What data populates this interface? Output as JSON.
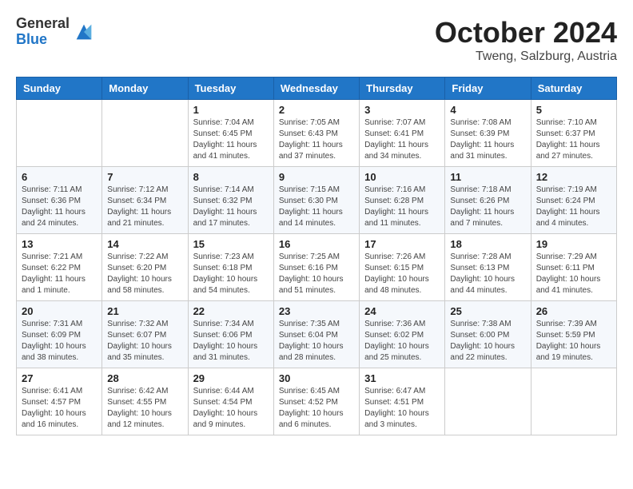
{
  "logo": {
    "general": "General",
    "blue": "Blue"
  },
  "header": {
    "month": "October 2024",
    "location": "Tweng, Salzburg, Austria"
  },
  "weekdays": [
    "Sunday",
    "Monday",
    "Tuesday",
    "Wednesday",
    "Thursday",
    "Friday",
    "Saturday"
  ],
  "weeks": [
    [
      {
        "day": "",
        "info": ""
      },
      {
        "day": "",
        "info": ""
      },
      {
        "day": "1",
        "info": "Sunrise: 7:04 AM\nSunset: 6:45 PM\nDaylight: 11 hours and 41 minutes."
      },
      {
        "day": "2",
        "info": "Sunrise: 7:05 AM\nSunset: 6:43 PM\nDaylight: 11 hours and 37 minutes."
      },
      {
        "day": "3",
        "info": "Sunrise: 7:07 AM\nSunset: 6:41 PM\nDaylight: 11 hours and 34 minutes."
      },
      {
        "day": "4",
        "info": "Sunrise: 7:08 AM\nSunset: 6:39 PM\nDaylight: 11 hours and 31 minutes."
      },
      {
        "day": "5",
        "info": "Sunrise: 7:10 AM\nSunset: 6:37 PM\nDaylight: 11 hours and 27 minutes."
      }
    ],
    [
      {
        "day": "6",
        "info": "Sunrise: 7:11 AM\nSunset: 6:36 PM\nDaylight: 11 hours and 24 minutes."
      },
      {
        "day": "7",
        "info": "Sunrise: 7:12 AM\nSunset: 6:34 PM\nDaylight: 11 hours and 21 minutes."
      },
      {
        "day": "8",
        "info": "Sunrise: 7:14 AM\nSunset: 6:32 PM\nDaylight: 11 hours and 17 minutes."
      },
      {
        "day": "9",
        "info": "Sunrise: 7:15 AM\nSunset: 6:30 PM\nDaylight: 11 hours and 14 minutes."
      },
      {
        "day": "10",
        "info": "Sunrise: 7:16 AM\nSunset: 6:28 PM\nDaylight: 11 hours and 11 minutes."
      },
      {
        "day": "11",
        "info": "Sunrise: 7:18 AM\nSunset: 6:26 PM\nDaylight: 11 hours and 7 minutes."
      },
      {
        "day": "12",
        "info": "Sunrise: 7:19 AM\nSunset: 6:24 PM\nDaylight: 11 hours and 4 minutes."
      }
    ],
    [
      {
        "day": "13",
        "info": "Sunrise: 7:21 AM\nSunset: 6:22 PM\nDaylight: 11 hours and 1 minute."
      },
      {
        "day": "14",
        "info": "Sunrise: 7:22 AM\nSunset: 6:20 PM\nDaylight: 10 hours and 58 minutes."
      },
      {
        "day": "15",
        "info": "Sunrise: 7:23 AM\nSunset: 6:18 PM\nDaylight: 10 hours and 54 minutes."
      },
      {
        "day": "16",
        "info": "Sunrise: 7:25 AM\nSunset: 6:16 PM\nDaylight: 10 hours and 51 minutes."
      },
      {
        "day": "17",
        "info": "Sunrise: 7:26 AM\nSunset: 6:15 PM\nDaylight: 10 hours and 48 minutes."
      },
      {
        "day": "18",
        "info": "Sunrise: 7:28 AM\nSunset: 6:13 PM\nDaylight: 10 hours and 44 minutes."
      },
      {
        "day": "19",
        "info": "Sunrise: 7:29 AM\nSunset: 6:11 PM\nDaylight: 10 hours and 41 minutes."
      }
    ],
    [
      {
        "day": "20",
        "info": "Sunrise: 7:31 AM\nSunset: 6:09 PM\nDaylight: 10 hours and 38 minutes."
      },
      {
        "day": "21",
        "info": "Sunrise: 7:32 AM\nSunset: 6:07 PM\nDaylight: 10 hours and 35 minutes."
      },
      {
        "day": "22",
        "info": "Sunrise: 7:34 AM\nSunset: 6:06 PM\nDaylight: 10 hours and 31 minutes."
      },
      {
        "day": "23",
        "info": "Sunrise: 7:35 AM\nSunset: 6:04 PM\nDaylight: 10 hours and 28 minutes."
      },
      {
        "day": "24",
        "info": "Sunrise: 7:36 AM\nSunset: 6:02 PM\nDaylight: 10 hours and 25 minutes."
      },
      {
        "day": "25",
        "info": "Sunrise: 7:38 AM\nSunset: 6:00 PM\nDaylight: 10 hours and 22 minutes."
      },
      {
        "day": "26",
        "info": "Sunrise: 7:39 AM\nSunset: 5:59 PM\nDaylight: 10 hours and 19 minutes."
      }
    ],
    [
      {
        "day": "27",
        "info": "Sunrise: 6:41 AM\nSunset: 4:57 PM\nDaylight: 10 hours and 16 minutes."
      },
      {
        "day": "28",
        "info": "Sunrise: 6:42 AM\nSunset: 4:55 PM\nDaylight: 10 hours and 12 minutes."
      },
      {
        "day": "29",
        "info": "Sunrise: 6:44 AM\nSunset: 4:54 PM\nDaylight: 10 hours and 9 minutes."
      },
      {
        "day": "30",
        "info": "Sunrise: 6:45 AM\nSunset: 4:52 PM\nDaylight: 10 hours and 6 minutes."
      },
      {
        "day": "31",
        "info": "Sunrise: 6:47 AM\nSunset: 4:51 PM\nDaylight: 10 hours and 3 minutes."
      },
      {
        "day": "",
        "info": ""
      },
      {
        "day": "",
        "info": ""
      }
    ]
  ]
}
